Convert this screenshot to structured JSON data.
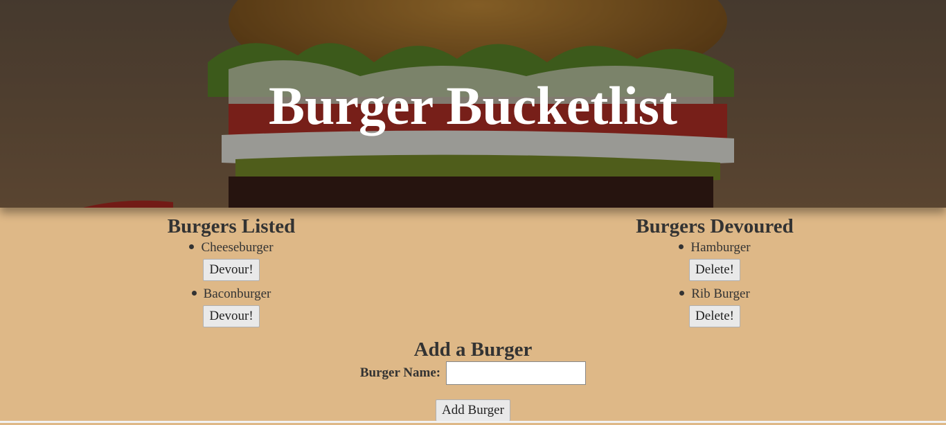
{
  "header": {
    "title": "Burger Bucketlist"
  },
  "listed": {
    "heading": "Burgers Listed",
    "items": [
      {
        "name": "Cheeseburger",
        "action": "Devour!"
      },
      {
        "name": "Baconburger",
        "action": "Devour!"
      }
    ]
  },
  "devoured": {
    "heading": "Burgers Devoured",
    "items": [
      {
        "name": "Hamburger",
        "action": "Delete!"
      },
      {
        "name": "Rib Burger",
        "action": "Delete!"
      }
    ]
  },
  "add_form": {
    "heading": "Add a Burger",
    "label": "Burger Name:",
    "input_value": "",
    "submit_label": "Add Burger"
  },
  "colors": {
    "page_background": "#deb887",
    "text": "#333333",
    "title": "#ffffff"
  }
}
